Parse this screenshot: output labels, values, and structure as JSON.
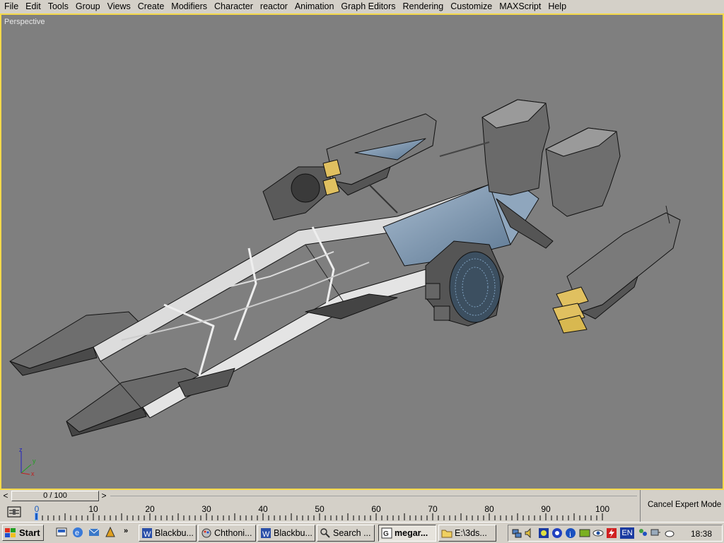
{
  "menubar": {
    "items": [
      "File",
      "Edit",
      "Tools",
      "Group",
      "Views",
      "Create",
      "Modifiers",
      "Character",
      "reactor",
      "Animation",
      "Graph Editors",
      "Rendering",
      "Customize",
      "MAXScript",
      "Help"
    ]
  },
  "viewport": {
    "label": "Perspective",
    "border_color": "#f5d94a",
    "background": "#7f7f7f",
    "axis_labels": {
      "z": "z",
      "y": "y",
      "x": "x"
    }
  },
  "timeslider": {
    "left_arrow": "<",
    "right_arrow": ">",
    "value": "0 / 100"
  },
  "trackbar": {
    "ticks": [
      "0",
      "10",
      "20",
      "30",
      "40",
      "50",
      "60",
      "70",
      "80",
      "90",
      "100"
    ]
  },
  "expert": {
    "label": "Cancel Expert Mode"
  },
  "taskbar": {
    "start_label": "Start",
    "quicklaunch_more": "»",
    "tasks": [
      {
        "label": "Blackbu...",
        "icon": "word-doc-icon"
      },
      {
        "label": "Chthoni...",
        "icon": "paint-icon"
      },
      {
        "label": "Blackbu...",
        "icon": "word-doc-icon"
      },
      {
        "label": "Search ...",
        "icon": "search-icon"
      },
      {
        "label": "megar...",
        "icon": "3dsmax-icon",
        "active": true
      },
      {
        "label": "E:\\3ds...",
        "icon": "folder-icon"
      }
    ],
    "tray_lang": "EN",
    "clock": "18:38"
  }
}
